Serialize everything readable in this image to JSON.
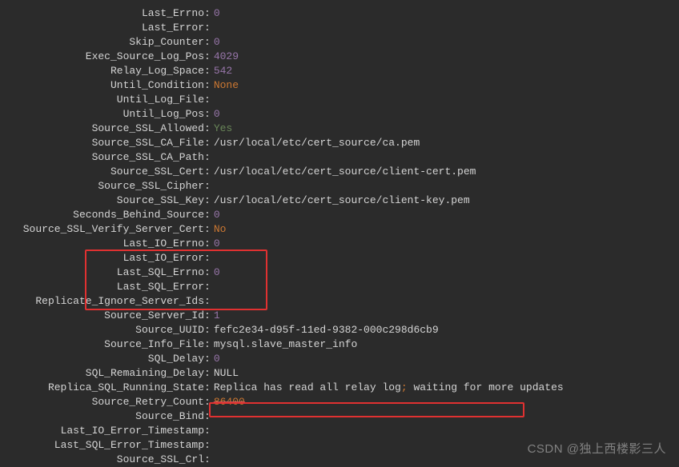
{
  "rows": [
    {
      "key": "Last_Errno",
      "val": "0",
      "cls": "num"
    },
    {
      "key": "Last_Error",
      "val": "",
      "cls": ""
    },
    {
      "key": "Skip_Counter",
      "val": "0",
      "cls": "num"
    },
    {
      "key": "Exec_Source_Log_Pos",
      "val": "4029",
      "cls": "num"
    },
    {
      "key": "Relay_Log_Space",
      "val": "542",
      "cls": "num"
    },
    {
      "key": "Until_Condition",
      "val": "None",
      "cls": "red"
    },
    {
      "key": "Until_Log_File",
      "val": "",
      "cls": ""
    },
    {
      "key": "Until_Log_Pos",
      "val": "0",
      "cls": "num"
    },
    {
      "key": "Source_SSL_Allowed",
      "val": "Yes",
      "cls": "green"
    },
    {
      "key": "Source_SSL_CA_File",
      "val": "/usr/local/etc/cert_source/ca.pem",
      "cls": ""
    },
    {
      "key": "Source_SSL_CA_Path",
      "val": "",
      "cls": ""
    },
    {
      "key": "Source_SSL_Cert",
      "val": "/usr/local/etc/cert_source/client-cert.pem",
      "cls": ""
    },
    {
      "key": "Source_SSL_Cipher",
      "val": "",
      "cls": ""
    },
    {
      "key": "Source_SSL_Key",
      "val": "/usr/local/etc/cert_source/client-key.pem",
      "cls": ""
    },
    {
      "key": "Seconds_Behind_Source",
      "val": "0",
      "cls": "num"
    },
    {
      "key": "Source_SSL_Verify_Server_Cert",
      "val": "No",
      "cls": "red"
    },
    {
      "key": "Last_IO_Errno",
      "val": "0",
      "cls": "num"
    },
    {
      "key": "Last_IO_Error",
      "val": "",
      "cls": ""
    },
    {
      "key": "Last_SQL_Errno",
      "val": "0",
      "cls": "num"
    },
    {
      "key": "Last_SQL_Error",
      "val": "",
      "cls": ""
    },
    {
      "key": "Replicate_Ignore_Server_Ids",
      "val": "",
      "cls": ""
    },
    {
      "key": "Source_Server_Id",
      "val": "1",
      "cls": "num"
    },
    {
      "key": "Source_UUID",
      "val": "fefc2e34-d95f-11ed-9382-000c298d6cb9",
      "cls": ""
    },
    {
      "key": "Source_Info_File",
      "val": "mysql.slave_master_info",
      "cls": ""
    },
    {
      "key": "SQL_Delay",
      "val": "0",
      "cls": "num"
    },
    {
      "key": "SQL_Remaining_Delay",
      "val": "NULL",
      "cls": ""
    },
    {
      "key": "Replica_SQL_Running_State",
      "val_special": true,
      "part1": "Replica has read all relay log",
      "part2": " waiting for more updates"
    },
    {
      "key": "Source_Retry_Count",
      "val": "86400",
      "cls": "struck"
    },
    {
      "key": "Source_Bind",
      "val": "",
      "cls": ""
    },
    {
      "key": "Last_IO_Error_Timestamp",
      "val": "",
      "cls": ""
    },
    {
      "key": "Last_SQL_Error_Timestamp",
      "val": "",
      "cls": ""
    },
    {
      "key": "Source_SSL_Crl",
      "val": "",
      "cls": ""
    }
  ],
  "watermark": "CSDN @独上西楼影三人"
}
